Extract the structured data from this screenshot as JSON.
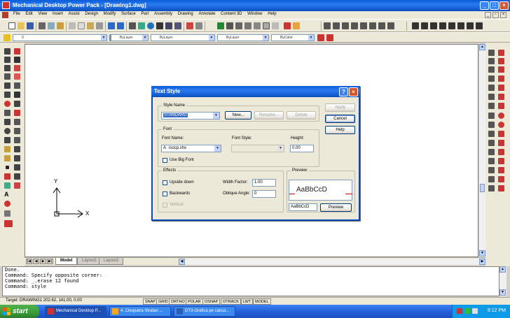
{
  "window": {
    "title": "Mechanical Desktop Power Pack - [Drawing1.dwg]",
    "minimize": "_",
    "maximize": "□",
    "close": "×"
  },
  "menu": {
    "items": [
      "File",
      "Edit",
      "View",
      "Insert",
      "Assist",
      "Design",
      "Modify",
      "Surface",
      "Part",
      "Assembly",
      "Drawing",
      "Annotate",
      "Content 3D",
      "Window",
      "Help"
    ]
  },
  "toolbar": {
    "layer": "0",
    "color": "ByLayer",
    "linetype": "ByLayer",
    "lineweight": "ByLayer",
    "plotstyle": "ByColor"
  },
  "drawing": {
    "ucs_y": "Y",
    "ucs_x": "X"
  },
  "tabs": {
    "model": "Model",
    "layout1": "Layout1",
    "layout2": "Layout2"
  },
  "command": {
    "lines": [
      "Done.",
      "Command: Specify opposite corner:",
      "Command: _.erase 12 found",
      "Command: style"
    ]
  },
  "status": {
    "coords": "Target: DRAWING1  202.62, 141.00, 0.00",
    "buttons": [
      "SNAP",
      "GRID",
      "ORTHO",
      "POLAR",
      "OSNAP",
      "OTRACK",
      "LWT",
      "MODEL"
    ]
  },
  "taskbar": {
    "start": "start",
    "items": [
      "Mechanical Desktop P...",
      "4. Cleopatra Stratan ...",
      "DT3-Grafica pe calcul..."
    ],
    "time": "9:12 PM"
  },
  "dialog": {
    "title": "Text Style",
    "help_icon": "?",
    "close_icon": "×",
    "style_name_group": "Style Name",
    "style_name_value": "STANDARD",
    "new_btn": "New...",
    "rename_btn": "Rename...",
    "delete_btn": "Delete",
    "apply_btn": "Apply",
    "cancel_btn": "Cancel",
    "help_btn": "Help",
    "font_group": "Font",
    "font_name_label": "Font Name:",
    "font_name_value": "isocp.shx",
    "font_style_label": "Font Style:",
    "font_style_value": "",
    "height_label": "Height:",
    "height_value": "0.00",
    "use_big_font": "Use Big Font",
    "effects_group": "Effects",
    "upside_down": "Upside down",
    "backwards": "Backwards",
    "vertical": "Vertical",
    "width_factor_label": "Width Factor:",
    "width_factor_value": "1.00",
    "oblique_label": "Oblique Angle:",
    "oblique_value": "0",
    "preview_group": "Preview",
    "preview_text": "AaBbCcD",
    "preview_input": "AaBbCcD",
    "preview_btn": "Preview"
  }
}
